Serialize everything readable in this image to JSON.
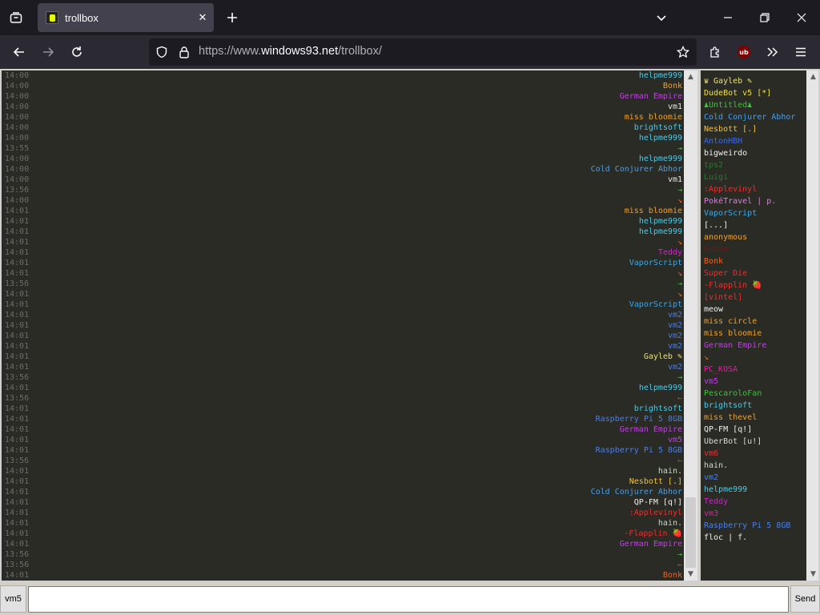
{
  "browser": {
    "tab_title": "trollbox",
    "url_prefix": "https://www.",
    "url_domain": "windows93.net",
    "url_path": "/trollbox/",
    "icons": {
      "tab_list": "tab-list-icon",
      "new_tab": "plus-icon",
      "list_all_tabs": "chevron-down-icon",
      "minimize": "minimize-icon",
      "maximize": "restore-icon",
      "close_window": "close-icon",
      "back": "back-arrow-icon",
      "forward": "forward-arrow-icon",
      "reload": "reload-icon",
      "tracking_protection": "shield-icon",
      "lock": "lock-icon",
      "bookmark": "star-icon",
      "extensions": "puzzle-icon",
      "ublock": "ublock-icon",
      "overflow": "double-chevron-icon",
      "menu": "hamburger-icon"
    },
    "ublock_label": "ub"
  },
  "messages": [
    {
      "time": "14:00",
      "nick": "helpme999",
      "color": "#4ec9e8"
    },
    {
      "time": "14:00",
      "nick": "Bonk",
      "color": "#f0a030"
    },
    {
      "time": "14:00",
      "nick": "German Empire",
      "color": "#c23ee8"
    },
    {
      "time": "14:00",
      "nick": "vm1",
      "color": "#e8e8e8"
    },
    {
      "time": "14:00",
      "nick": "miss bloomie",
      "color": "#f0a030"
    },
    {
      "time": "14:00",
      "nick": "brightsoft",
      "color": "#4ec9e8"
    },
    {
      "time": "14:00",
      "nick": "helpme999",
      "color": "#4ec9e8"
    },
    {
      "time": "13:55",
      "nick": "→",
      "color": "#3cc23c"
    },
    {
      "time": "14:00",
      "nick": "helpme999",
      "color": "#4ec9e8"
    },
    {
      "time": "14:00",
      "nick": "Cold Conjurer Abhor",
      "color": "#4a9ee8"
    },
    {
      "time": "14:00",
      "nick": "vm1",
      "color": "#e8e8e8"
    },
    {
      "time": "13:56",
      "nick": "→",
      "color": "#3cc23c"
    },
    {
      "time": "14:00",
      "nick": "↘",
      "color": "#f06020"
    },
    {
      "time": "14:01",
      "nick": "miss bloomie",
      "color": "#f0a030"
    },
    {
      "time": "14:01",
      "nick": "helpme999",
      "color": "#4ec9e8"
    },
    {
      "time": "14:01",
      "nick": "helpme999",
      "color": "#4ec9e8"
    },
    {
      "time": "14:01",
      "nick": "↘",
      "color": "#f06020"
    },
    {
      "time": "14:01",
      "nick": "Teddy",
      "color": "#d020d0"
    },
    {
      "time": "14:01",
      "nick": "VaporScript",
      "color": "#3aa8e8"
    },
    {
      "time": "14:01",
      "nick": "↘",
      "color": "#f06020"
    },
    {
      "time": "13:56",
      "nick": "→",
      "color": "#3cc23c"
    },
    {
      "time": "14:01",
      "nick": "↘",
      "color": "#f06020"
    },
    {
      "time": "14:01",
      "nick": "VaporScript",
      "color": "#3aa8e8"
    },
    {
      "time": "14:01",
      "nick": "vm2",
      "color": "#4a7ee8"
    },
    {
      "time": "14:01",
      "nick": "vm2",
      "color": "#4a7ee8"
    },
    {
      "time": "14:01",
      "nick": "vm2",
      "color": "#4a7ee8"
    },
    {
      "time": "14:01",
      "nick": "vm2",
      "color": "#4a7ee8"
    },
    {
      "time": "14:01",
      "nick": "Gayleb ✎",
      "color": "#e8e070"
    },
    {
      "time": "14:01",
      "nick": "vm2",
      "color": "#4a7ee8"
    },
    {
      "time": "13:56",
      "nick": "→",
      "color": "#3cc23c"
    },
    {
      "time": "14:01",
      "nick": "helpme999",
      "color": "#4ec9e8"
    },
    {
      "time": "13:56",
      "nick": "←",
      "color": "#e83030"
    },
    {
      "time": "14:01",
      "nick": "brightsoft",
      "color": "#4ec9e8"
    },
    {
      "time": "14:01",
      "nick": "Raspberry Pi 5 8GB",
      "color": "#4a7ee8"
    },
    {
      "time": "14:01",
      "nick": "German Empire",
      "color": "#c23ee8"
    },
    {
      "time": "14:01",
      "nick": "vm5",
      "color": "#c23ee8"
    },
    {
      "time": "14:01",
      "nick": "Raspberry Pi 5 8GB",
      "color": "#4a7ee8"
    },
    {
      "time": "13:56",
      "nick": "←",
      "color": "#e83030"
    },
    {
      "time": "14:01",
      "nick": "hain.",
      "color": "#c8d8c8"
    },
    {
      "time": "14:01",
      "nick": "Nesbott [.]",
      "color": "#f0c040"
    },
    {
      "time": "14:01",
      "nick": "Cold Conjurer Abhor",
      "color": "#4a9ee8"
    },
    {
      "time": "14:01",
      "nick": "QP-FM [q!]",
      "color": "#f0f0f0"
    },
    {
      "time": "14:01",
      "nick": ":Applevinyl",
      "color": "#e83030"
    },
    {
      "time": "14:01",
      "nick": "hain.",
      "color": "#c8d8c8"
    },
    {
      "time": "14:01",
      "nick": "-Flapplin 🍓",
      "color": "#e83030"
    },
    {
      "time": "14:01",
      "nick": "German Empire",
      "color": "#c23ee8"
    },
    {
      "time": "13:56",
      "nick": "→",
      "color": "#3cc23c"
    },
    {
      "time": "13:56",
      "nick": "←",
      "color": "#e83030"
    },
    {
      "time": "14:01",
      "nick": "Bonk",
      "color": "#f06020"
    }
  ],
  "users": [
    {
      "name": "♛ Gayleb ✎",
      "color": "#e8e070"
    },
    {
      "name": "DudeBot v5 [*]",
      "color": "#f0e040"
    },
    {
      "name": "♟Untitled♟",
      "color": "#3cc23c"
    },
    {
      "name": "Cold Conjurer Abhor",
      "color": "#4a9ee8"
    },
    {
      "name": "Nesbott [.]",
      "color": "#f0c040"
    },
    {
      "name": "AntonHBH",
      "color": "#3a6ae8"
    },
    {
      "name": "bigweirdo",
      "color": "#f0f0f0"
    },
    {
      "name": "tps2",
      "color": "#2a7a2a"
    },
    {
      "name": "Luigi",
      "color": "#2a7a2a"
    },
    {
      "name": ":Applevinyl",
      "color": "#e83030"
    },
    {
      "name": "PokéTravel | p.",
      "color": "#d880d8"
    },
    {
      "name": "VaporScript",
      "color": "#3aa8e8"
    },
    {
      "name": "[...]",
      "color": "#f0f0f0"
    },
    {
      "name": "anonymous",
      "color": "#f0a030"
    },
    {
      "name": "Grimm",
      "color": "#6a1a1a"
    },
    {
      "name": "Bonk",
      "color": "#f06020"
    },
    {
      "name": "Super Die",
      "color": "#e83030"
    },
    {
      "name": "-Flapplin 🍓",
      "color": "#e83030"
    },
    {
      "name": "[vintel]",
      "color": "#e83030"
    },
    {
      "name": "meow",
      "color": "#f0f0f0"
    },
    {
      "name": "miss circle",
      "color": "#f0a030"
    },
    {
      "name": "miss bloomie",
      "color": "#f0a030"
    },
    {
      "name": "German Empire",
      "color": "#c23ee8"
    },
    {
      "name": "↘",
      "color": "#f06020"
    },
    {
      "name": "PC_KOSA",
      "color": "#e020a0"
    },
    {
      "name": "vm5",
      "color": "#c23ee8"
    },
    {
      "name": "PescaroloFan",
      "color": "#3cc23c"
    },
    {
      "name": "brightsoft",
      "color": "#4ec9e8"
    },
    {
      "name": "miss thevel",
      "color": "#f0a030"
    },
    {
      "name": "QP-FM [q!]",
      "color": "#f0f0f0"
    },
    {
      "name": "UberBot [u!]",
      "color": "#d8d8d8"
    },
    {
      "name": "vm6",
      "color": "#e83030"
    },
    {
      "name": "hain.",
      "color": "#c8d8c8"
    },
    {
      "name": "vm2",
      "color": "#4a7ee8"
    },
    {
      "name": "helpme999",
      "color": "#4ec9e8"
    },
    {
      "name": "Teddy",
      "color": "#d020d0"
    },
    {
      "name": "vm3",
      "color": "#e020a0"
    },
    {
      "name": "Raspberry Pi 5 8GB",
      "color": "#4a7ee8"
    },
    {
      "name": "floc | f.",
      "color": "#f0f0f0"
    }
  ],
  "input": {
    "nick_label": "vm5",
    "placeholder": "",
    "value": "",
    "send_label": "Send"
  }
}
